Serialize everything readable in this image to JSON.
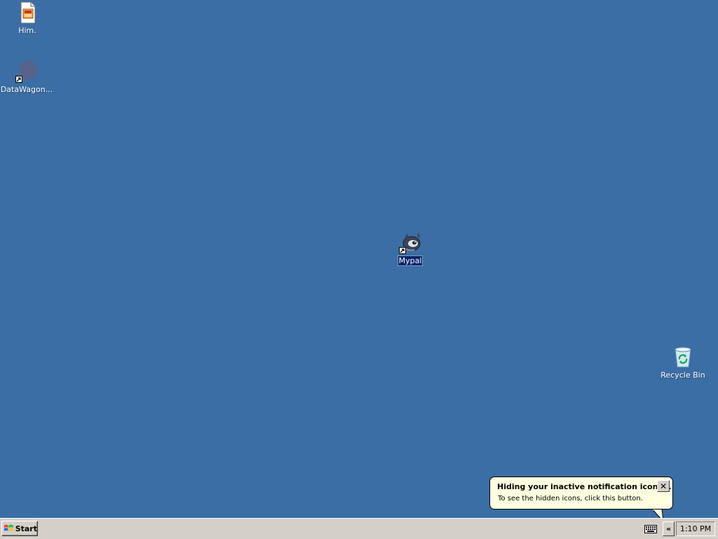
{
  "desktop": {
    "background_color": "#3a6ea5",
    "icons": [
      {
        "label": "Him.",
        "icon": "document-image-icon",
        "shortcut": false,
        "selected": false
      },
      {
        "label": "DataWagon...",
        "icon": "datawagon-icon",
        "shortcut": true,
        "selected": false
      },
      {
        "label": "Mypal",
        "icon": "mypal-browser-icon",
        "shortcut": true,
        "selected": true
      },
      {
        "label": "Recycle Bin",
        "icon": "recycle-bin-icon",
        "shortcut": false,
        "selected": false
      }
    ]
  },
  "balloon": {
    "title": "Hiding your inactive notification icons...",
    "body": "To see the hidden icons, click this button.",
    "close_label": "✕"
  },
  "taskbar": {
    "start_label": "Start",
    "expand_label": "«",
    "clock": "1:10 PM"
  }
}
